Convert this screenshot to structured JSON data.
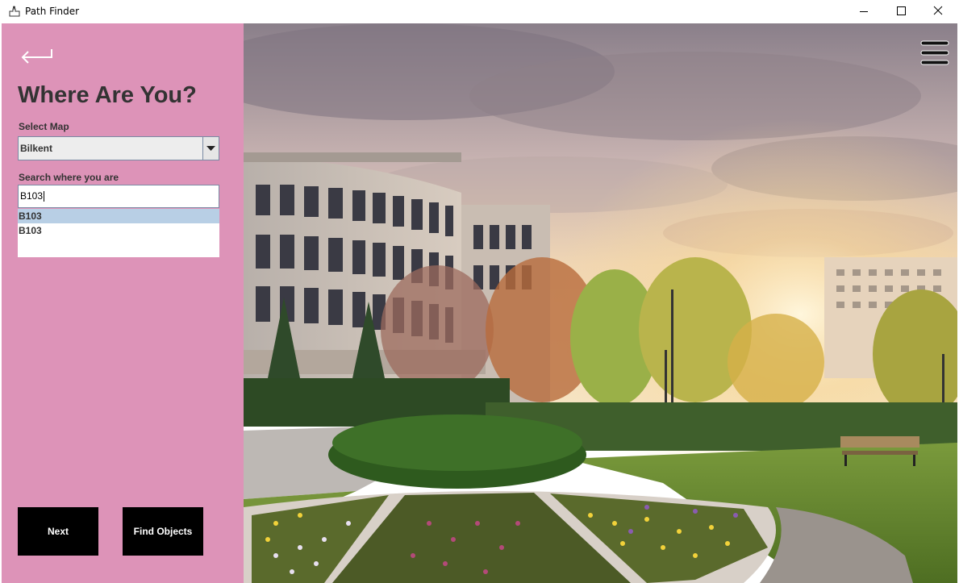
{
  "window": {
    "title": "Path Finder",
    "icon": "app-icon",
    "controls": [
      "minimize-icon",
      "maximize-icon",
      "close-icon"
    ]
  },
  "left_panel": {
    "background_color": "#dd93b8",
    "back_icon": "back-arrow-icon",
    "heading": "Where Are You?",
    "select_map": {
      "label": "Select Map",
      "value": "Bilkent",
      "icon": "chevron-down-icon"
    },
    "search": {
      "label": "Search where you are",
      "value": "B103"
    },
    "suggestions": [
      {
        "label": "B103",
        "selected": true
      },
      {
        "label": "B103",
        "selected": false
      }
    ],
    "buttons": {
      "next": "Next",
      "find_objects": "Find Objects"
    }
  },
  "scene": {
    "description_icon": "campus-photo",
    "menu_icon": "hamburger-menu-icon"
  }
}
